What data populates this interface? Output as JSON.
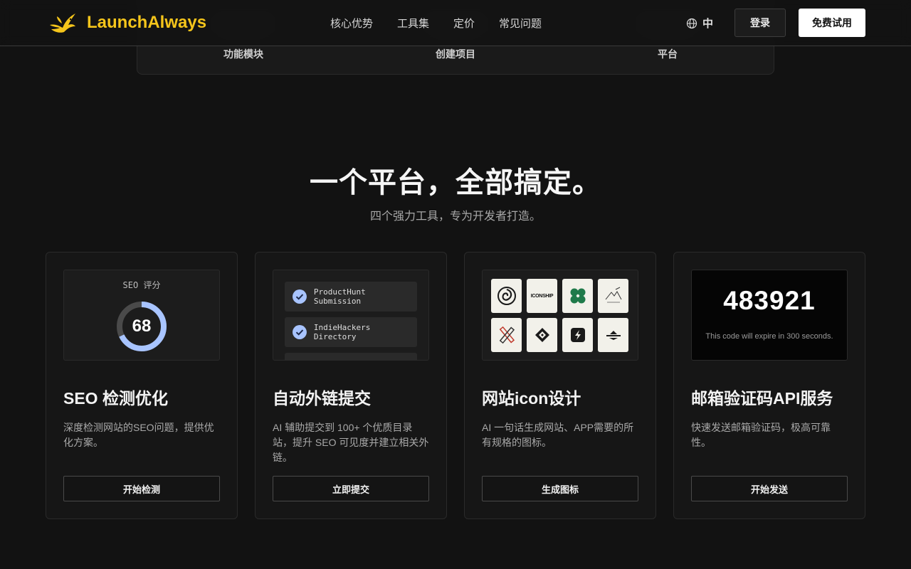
{
  "header": {
    "brand": "LaunchAlways",
    "nav": [
      "核心优势",
      "工具集",
      "定价",
      "常见问题"
    ],
    "lang": "中",
    "login": "登录",
    "trial": "免费试用",
    "accent_color": "#f5c51b"
  },
  "stats": [
    "功能模块",
    "创建项目",
    "平台"
  ],
  "section": {
    "title": "一个平台，全部搞定。",
    "subtitle": "四个强力工具，专为开发者打造。"
  },
  "cards": [
    {
      "title": "SEO 检测优化",
      "desc": "深度检测网站的SEO问题，提供优化方案。",
      "button": "开始检测",
      "preview_label": "SEO 评分",
      "score": "68",
      "score_value": 68
    },
    {
      "title": "自动外链提交",
      "desc": "AI 辅助提交到 100+ 个优质目录站，提升 SEO 可见度并建立相关外链。",
      "button": "立即提交",
      "items": [
        "ProductHunt Submission",
        "IndieHackers Directory"
      ]
    },
    {
      "title": "网站icon设计",
      "desc": "AI 一句话生成网站、APP需要的所有规格的图标。",
      "button": "生成图标",
      "icons": [
        "swirl-logo-icon",
        "iconship-wordmark-icon",
        "clover-icon",
        "mountain-sketch-icon",
        "pencil-ruler-icon",
        "diamond-pattern-icon",
        "lightning-s-icon",
        "horizon-wordmark-icon"
      ],
      "wordmark": "ICONSHIP"
    },
    {
      "title": "邮箱验证码API服务",
      "desc": "快速发送邮箱验证码，极高可靠性。",
      "button": "开始发送",
      "code": "483921",
      "code_note": "This code will expire in 300 seconds."
    }
  ]
}
